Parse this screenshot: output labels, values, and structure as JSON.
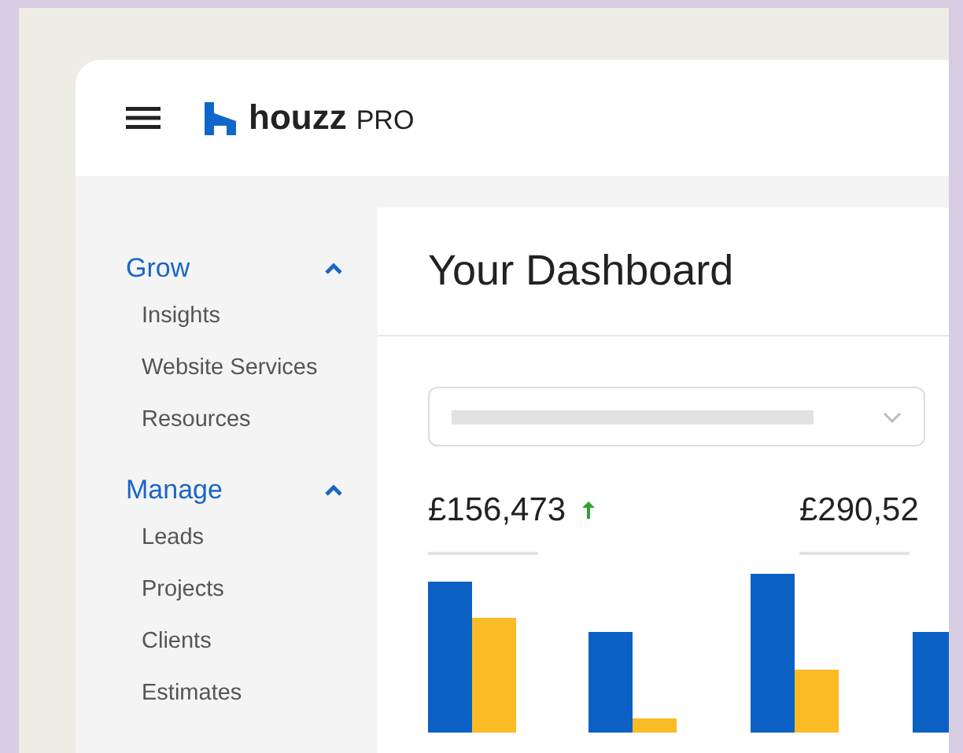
{
  "header": {
    "brand": "houzz",
    "brand_suffix": "PRO"
  },
  "sidebar": {
    "sections": [
      {
        "title": "Grow",
        "expanded": true,
        "items": [
          "Insights",
          "Website Services",
          "Resources"
        ]
      },
      {
        "title": "Manage",
        "expanded": true,
        "items": [
          "Leads",
          "Projects",
          "Clients",
          "Estimates"
        ]
      }
    ]
  },
  "main": {
    "title": "Your Dashboard",
    "metrics": [
      {
        "value": "£156,473",
        "rising": true
      },
      {
        "value": "£290,52",
        "rising": false
      }
    ]
  }
}
